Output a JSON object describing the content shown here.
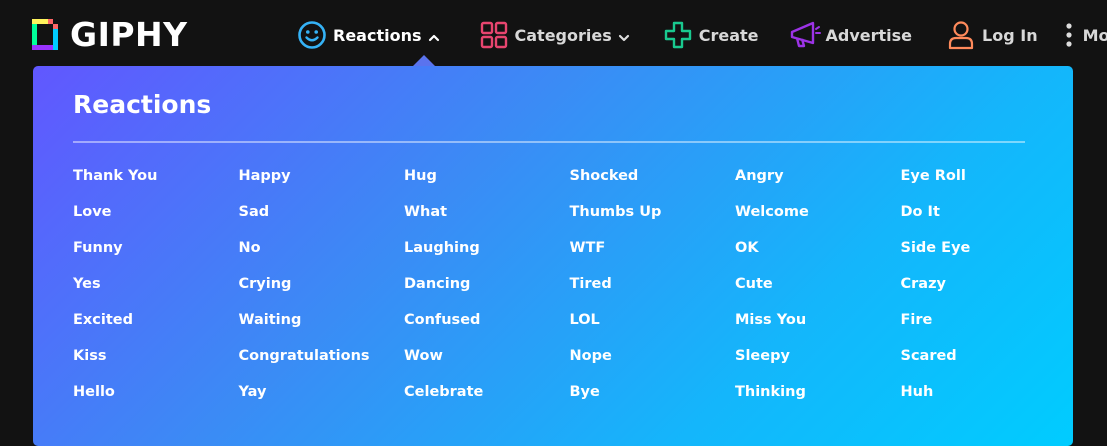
{
  "brand": {
    "name": "GIPHY"
  },
  "nav": {
    "reactions": "Reactions",
    "categories": "Categories",
    "create": "Create",
    "advertise": "Advertise",
    "login": "Log In",
    "more": "More"
  },
  "colors": {
    "reactions_icon": "#35b2f6",
    "categories_icon": "#e8456f",
    "create_icon": "#19c98f",
    "advertise_icon": "#9c33e6",
    "login_icon": "#ff8a5b"
  },
  "dropdown": {
    "title": "Reactions",
    "columns": [
      [
        "Thank You",
        "Love",
        "Funny",
        "Yes",
        "Excited",
        "Kiss",
        "Hello"
      ],
      [
        "Happy",
        "Sad",
        "No",
        "Crying",
        "Waiting",
        "Congratulations",
        "Yay"
      ],
      [
        "Hug",
        "What",
        "Laughing",
        "Dancing",
        "Confused",
        "Wow",
        "Celebrate"
      ],
      [
        "Shocked",
        "Thumbs Up",
        "WTF",
        "Tired",
        "LOL",
        "Nope",
        "Bye"
      ],
      [
        "Angry",
        "Welcome",
        "OK",
        "Cute",
        "Miss You",
        "Sleepy",
        "Thinking"
      ],
      [
        "Eye Roll",
        "Do It",
        "Side Eye",
        "Crazy",
        "Fire",
        "Scared",
        "Huh"
      ]
    ]
  }
}
